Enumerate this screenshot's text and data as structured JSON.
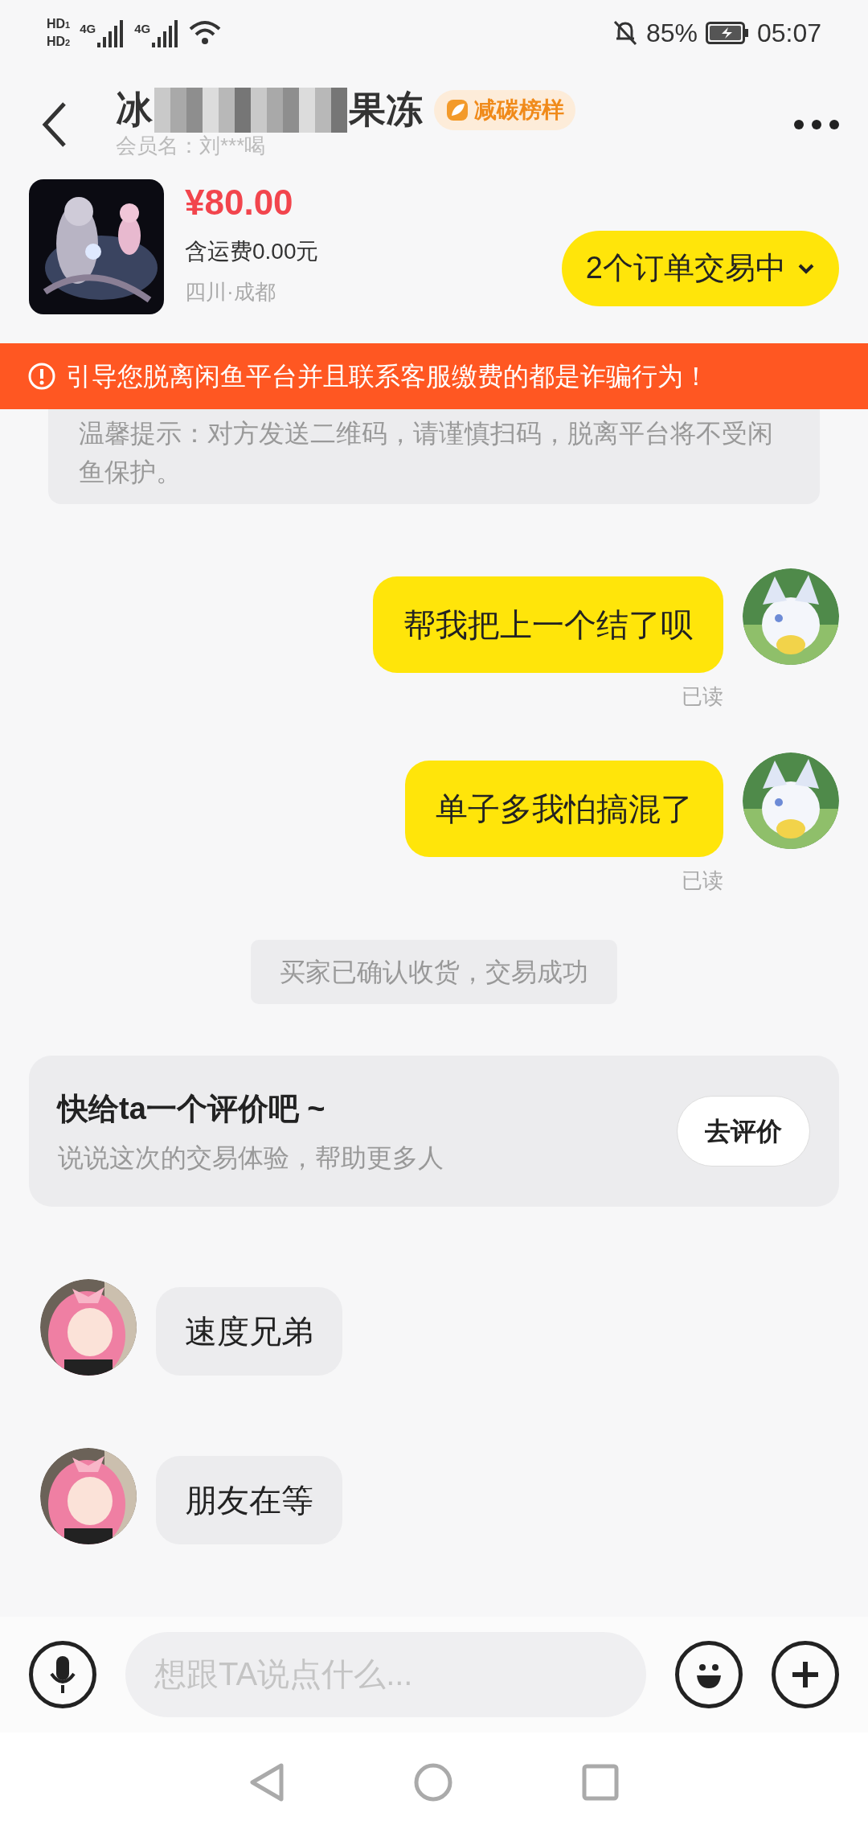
{
  "status_bar": {
    "sims": [
      {
        "label": "HD",
        "slot": "1",
        "network": "4G"
      },
      {
        "label": "HD",
        "slot": "2",
        "network": "4G"
      }
    ],
    "battery": "85%",
    "time": "05:07"
  },
  "header": {
    "title_start": "冰",
    "title_end": "果冻",
    "badge": "减碳榜样",
    "member": "会员名：刘***喝"
  },
  "product": {
    "price": "¥80.00",
    "shipping": "含运费0.00元",
    "location": "四川·成都",
    "orders_button": "2个订单交易中"
  },
  "warning": "引导您脱离闲鱼平台并且联系客服缴费的都是诈骗行为！",
  "tip": "温馨提示：对方发送二维码，请谨慎扫码，脱离平台将不受闲鱼保护。",
  "messages": [
    {
      "kind": "sent",
      "text": "帮我把上一个结了呗",
      "status": "已读"
    },
    {
      "kind": "sent",
      "text": "单子多我怕搞混了",
      "status": "已读"
    },
    {
      "kind": "system",
      "text": "买家已确认收货，交易成功"
    },
    {
      "kind": "review",
      "title": "快给ta一个评价吧 ~",
      "subtitle": "说说这次的交易体验，帮助更多人",
      "button": "去评价"
    },
    {
      "kind": "received",
      "text": "速度兄弟"
    },
    {
      "kind": "received",
      "text": "朋友在等"
    }
  ],
  "input": {
    "placeholder": "想跟TA说点什么..."
  }
}
